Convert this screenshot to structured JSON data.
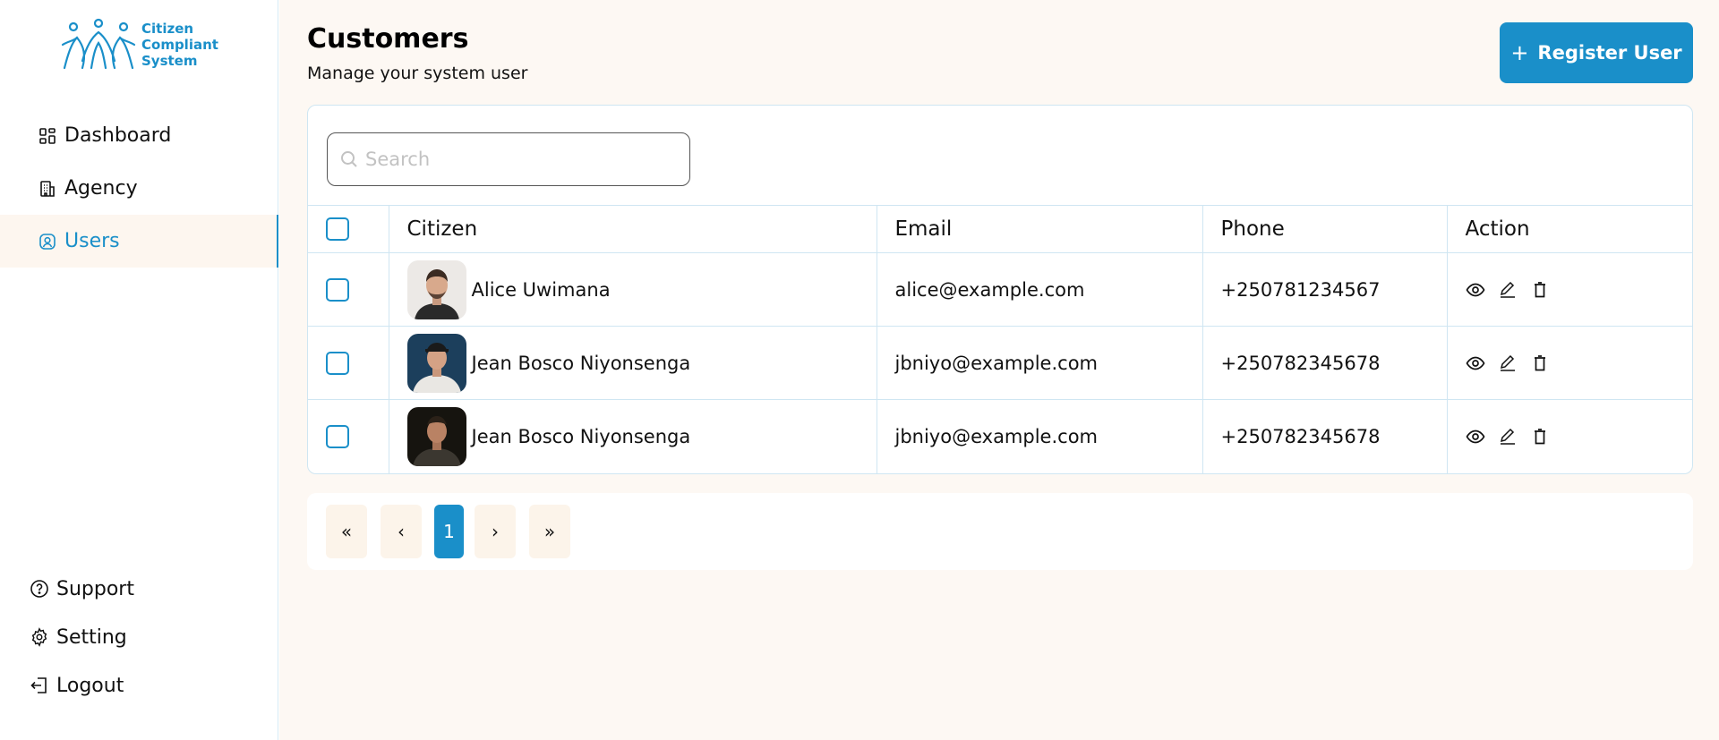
{
  "brand": {
    "line1": "Citizen",
    "line2": "Compliant",
    "line3": "System",
    "color": "#1a8fc9"
  },
  "sidebar": {
    "items": [
      {
        "label": "Dashboard",
        "icon": "dashboard-icon"
      },
      {
        "label": "Agency",
        "icon": "building-icon"
      },
      {
        "label": "Users",
        "icon": "user-circle-icon",
        "active": true
      }
    ],
    "bottom": [
      {
        "label": "Support",
        "icon": "help-icon"
      },
      {
        "label": "Setting",
        "icon": "gear-icon"
      },
      {
        "label": "Logout",
        "icon": "logout-icon"
      }
    ]
  },
  "header": {
    "title": "Customers",
    "subtitle": "Manage your system user",
    "register_label": "Register User"
  },
  "search": {
    "placeholder": "Search"
  },
  "table": {
    "columns": [
      "Citizen",
      "Email",
      "Phone",
      "Action"
    ],
    "rows": [
      {
        "name": "Alice Uwimana",
        "email": "alice@example.com",
        "phone": "+250781234567"
      },
      {
        "name": "Jean Bosco Niyonsenga",
        "email": "jbniyo@example.com",
        "phone": "+250782345678"
      },
      {
        "name": "Jean Bosco Niyonsenga",
        "email": "jbniyo@example.com",
        "phone": "+250782345678"
      }
    ]
  },
  "pagination": {
    "first": "«",
    "prev": "‹",
    "current": "1",
    "next": "›",
    "last": "»"
  }
}
